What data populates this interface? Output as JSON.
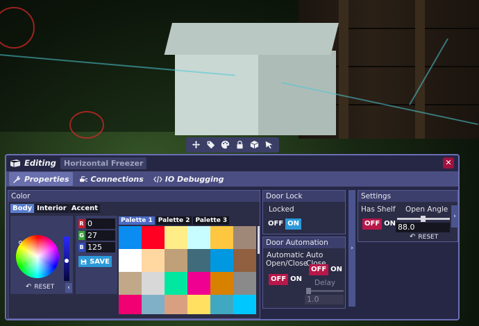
{
  "toolbar": {
    "tools": [
      {
        "icon": "move-icon"
      },
      {
        "icon": "tag-icon"
      },
      {
        "icon": "palette-icon"
      },
      {
        "icon": "lock-icon"
      },
      {
        "icon": "cube-icon"
      },
      {
        "icon": "pointer-icon"
      }
    ]
  },
  "editor": {
    "mode_label": "Editing",
    "object_name": "Horizontal Freezer",
    "close_label": "✕",
    "tabs": [
      {
        "label": "Properties",
        "icon": "wrench-icon",
        "active": true
      },
      {
        "label": "Connections",
        "icon": "plug-icon",
        "active": false
      },
      {
        "label": "IO Debugging",
        "icon": "code-icon",
        "active": false
      }
    ]
  },
  "color": {
    "title": "Color",
    "subtabs": [
      "Body",
      "Interior",
      "Accent"
    ],
    "active_subtab": "Body",
    "reset_label": "RESET",
    "rgb": {
      "r_tag": "R",
      "g_tag": "G",
      "b_tag": "B",
      "r": "0",
      "g": "27",
      "b": "125"
    },
    "save_label": "SAVE",
    "palette_tabs": [
      "Palette 1",
      "Palette 2",
      "Palette 3"
    ],
    "active_palette": "Palette 1",
    "swatches": [
      "#0a8cf0",
      "#ff0022",
      "#ffee88",
      "#c8fdff",
      "#ffc640",
      "#a08878",
      "#ffffff",
      "#ffd7a0",
      "#c0a078",
      "#3f6b7a",
      "#0098e0",
      "#906040",
      "#c0a888",
      "#d8d8d8",
      "#00e8a0",
      "#f00090",
      "#d88000",
      "#8a8a8a",
      "#f00070",
      "#80b0c8",
      "#d8a080",
      "#ffe060",
      "#40a8c0",
      "#00c8ff"
    ]
  },
  "door_lock": {
    "title": "Door Lock",
    "locked_label": "Locked",
    "off_label": "OFF",
    "on_label": "ON",
    "value": "ON"
  },
  "door_automation": {
    "title": "Door Automation",
    "automatic_label_line1": "Automatic",
    "automatic_label_line2": "Open/Close",
    "auto_close_label": "Auto Close",
    "delay_label": "Delay",
    "delay_value": "1.0",
    "off_label": "OFF",
    "on_label": "ON",
    "automatic_value": "OFF",
    "auto_close_value": "OFF"
  },
  "settings": {
    "title": "Settings",
    "has_shelf_label": "Has Shelf",
    "open_angle_label": "Open Angle",
    "open_angle_value": "88.0",
    "open_angle_fraction": 0.49,
    "reset_label": "RESET",
    "off_label": "OFF",
    "on_label": "ON",
    "has_shelf_value": "OFF"
  },
  "colors": {
    "accent_blue": "#2c99d8",
    "off_red": "#b8174a",
    "panel_bg": "#2b2c46",
    "frame_border": "#6b6fb6"
  }
}
